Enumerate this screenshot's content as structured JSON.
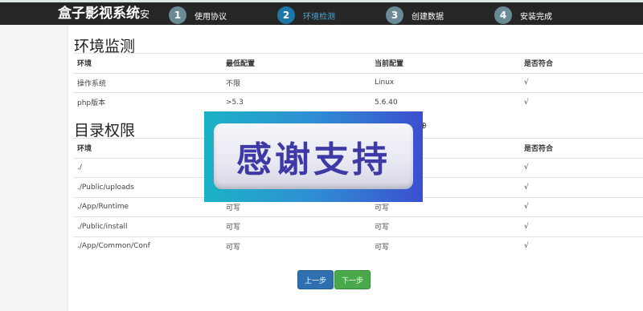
{
  "app": {
    "title": "盒子影视系统",
    "title_tail": "安"
  },
  "steps": [
    {
      "number": "1",
      "label": "使用协议",
      "active": false
    },
    {
      "number": "2",
      "label": "环境检测",
      "active": true
    },
    {
      "number": "3",
      "label": "创建数据",
      "active": false
    },
    {
      "number": "4",
      "label": "安装完成",
      "active": false
    }
  ],
  "env_section": {
    "title": "环境监测",
    "headers": [
      "环境",
      "最低配置",
      "当前配置",
      "是否符合"
    ],
    "rows": [
      [
        "操作系统",
        "不限",
        "Linux",
        "√"
      ],
      [
        "php版本",
        ">5.3",
        "5.6.40",
        "√"
      ]
    ]
  },
  "dir_section": {
    "title": "目录权限",
    "headers": [
      "环境",
      "",
      "",
      "是否符合"
    ],
    "rows": [
      [
        "./",
        "",
        "",
        "√"
      ],
      [
        "./Public/uploads",
        "",
        "",
        "√"
      ],
      [
        "./App/Runtime",
        "可写",
        "可写",
        "√"
      ],
      [
        "./Public/install",
        "可写",
        "可写",
        "√"
      ],
      [
        "./App/Common/Conf",
        "可写",
        "可写",
        "√"
      ]
    ]
  },
  "overlay": {
    "text": "感谢支持"
  },
  "stray_glyph": "⊕",
  "buttons": {
    "prev": "上一步",
    "next": "下一步"
  },
  "colors": {
    "topbar": "#262626",
    "step_active": "#1d78a8",
    "step_inactive": "#6a8a96",
    "prev_button": "#2f6fb0",
    "next_button": "#49a94a"
  }
}
